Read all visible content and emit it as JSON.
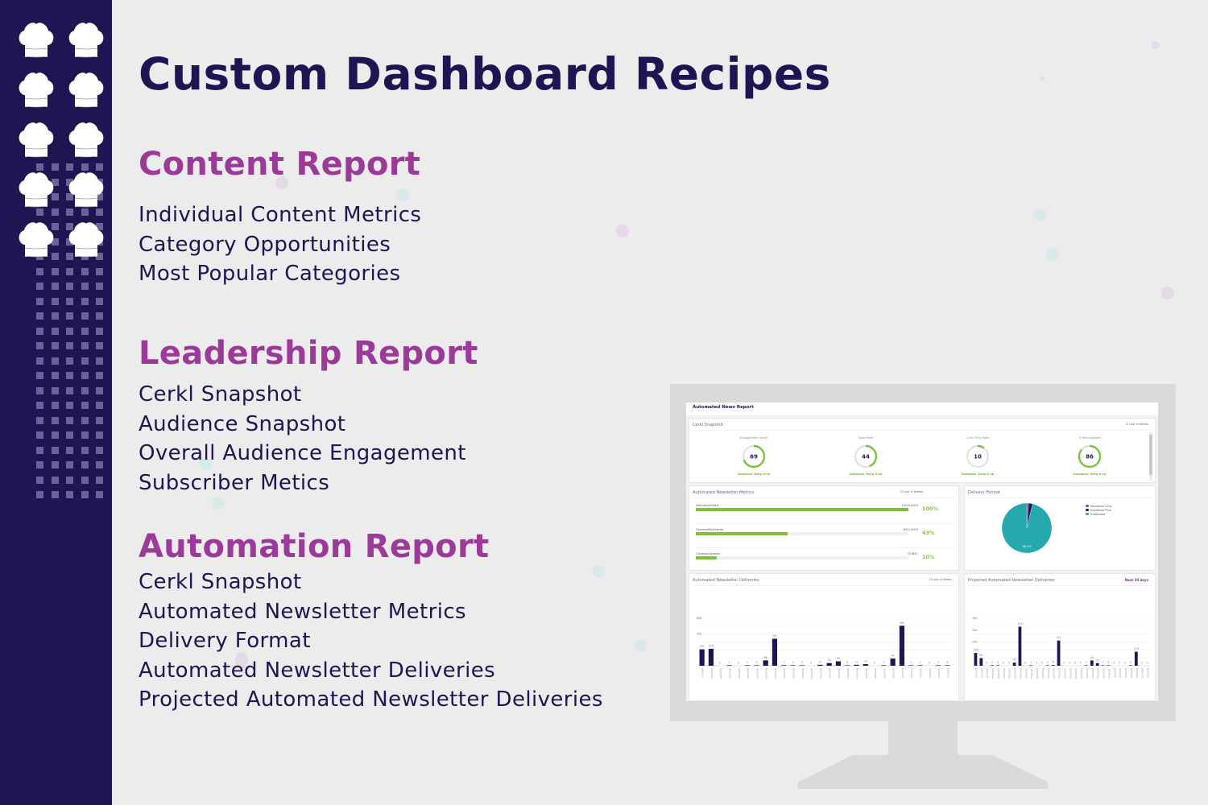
{
  "page": {
    "title": "Custom Dashboard Recipes",
    "colors": {
      "navy": "#1f1553",
      "purple": "#9b3a99",
      "background": "#ececec",
      "green": "#7dc23d",
      "teal": "#25a8ae"
    }
  },
  "sections": [
    {
      "title": "Content Report",
      "items": [
        "Individual Content Metrics",
        "Category Opportunities",
        "Most Popular Categories"
      ]
    },
    {
      "title": "Leadership Report",
      "items": [
        "Cerkl Snapshot",
        "Audience Snapshot",
        "Overall Audience Engagement",
        "Subscriber Metics"
      ]
    },
    {
      "title": "Automation Report",
      "items": [
        "Cerkl Snapshot",
        "Automated Newsletter Metrics",
        "Delivery Format",
        "Automated Newsletter Deliveries",
        "Projected Automated Newsletter Deliveries"
      ]
    }
  ],
  "sidebar": {
    "icons": [
      "chef-hat-icon",
      "chef-hat-icon",
      "chef-hat-icon",
      "chef-hat-icon",
      "chef-hat-icon",
      "chef-hat-icon",
      "chef-hat-icon",
      "chef-hat-icon",
      "chef-hat-icon",
      "chef-hat-icon"
    ]
  },
  "dashboard": {
    "header": "Automated News Report",
    "snapshot": {
      "title": "Cerkl Snapshot",
      "range": "☷ Last 4 Weeks",
      "gauges": [
        {
          "label": "Engagement Score",
          "value": 69,
          "status": "Awesome, Keep it up"
        },
        {
          "label": "Open Rate",
          "value": 44,
          "status": "Awesome, Keep it up"
        },
        {
          "label": "Click-Thru Rate",
          "value": 10,
          "status": "Awesome, Keep it up"
        },
        {
          "label": "% Personalized",
          "value": 86,
          "status": "Awesome, Keep it up"
        }
      ]
    },
    "metrics": {
      "title": "Automated Newsletter Metrics",
      "range": "☷ Last 4 Weeks",
      "rows": [
        {
          "label": "Delivered/Sent",
          "count": "1505/1505",
          "percent": "100%",
          "fraction": 1.0
        },
        {
          "label": "Opened/Delivered",
          "count": "651/1505",
          "percent": "43%",
          "fraction": 0.43
        },
        {
          "label": "Clicked/Opened",
          "count": "72/651",
          "percent": "10%",
          "fraction": 0.1
        }
      ]
    },
    "delivery_format": {
      "title": "Delivery Format",
      "legend": [
        {
          "label": "Headlines Only",
          "color": "#9b3a99"
        },
        {
          "label": "Headlines Plus",
          "color": "#1f1553"
        },
        {
          "label": "Traditional",
          "color": "#25a8ae"
        }
      ],
      "center_label": "96.2%"
    },
    "deliveries": {
      "title": "Automated Newsletter Deliveries",
      "range": "☷ Last 4 Weeks"
    },
    "projected": {
      "title": "Projected Automated Newsletter Deliveries",
      "range": "Next 30 days"
    }
  },
  "chart_data": [
    {
      "type": "pie",
      "title": "Delivery Format",
      "categories": [
        "Headlines Only",
        "Headlines Plus",
        "Traditional"
      ],
      "values": [
        1.2,
        2.6,
        96.2
      ],
      "data_labels": [
        "",
        "",
        "96.2%"
      ],
      "legend": "top-right"
    },
    {
      "type": "bar",
      "title": "Automated Newsletter Deliveries",
      "categories": [
        "4/9/2019",
        "4/10/2019",
        "4/11/2019",
        "4/12/2019",
        "4/13/2019",
        "4/14/2019",
        "4/15/2019",
        "4/16/2019",
        "4/17/2019",
        "4/18/2019",
        "4/19/2019",
        "4/20/2019",
        "4/21/2019",
        "4/22/2019",
        "4/23/2019",
        "4/24/2019",
        "4/25/2019",
        "4/26/2019",
        "4/27/2019",
        "4/28/2019",
        "4/29/2019",
        "4/30/2019",
        "5/1/2019",
        "5/2/2019",
        "5/3/2019",
        "5/4/2019",
        "5/5/2019",
        "5/6/2019"
      ],
      "values": [
        207,
        214,
        0,
        1,
        0,
        1,
        3,
        68,
        341,
        7,
        3,
        3,
        0,
        12,
        34,
        56,
        6,
        12,
        20,
        0,
        1,
        90,
        505,
        1,
        3,
        0,
        3,
        6
      ],
      "data_labels": [
        "207",
        "214",
        "0",
        "1",
        "0",
        "1",
        "3",
        "68",
        "341",
        "7",
        "3",
        "3",
        "0",
        "12",
        "34",
        "56",
        "6",
        "12",
        "20",
        "0",
        "1",
        "90",
        "505",
        "1",
        "3",
        "0",
        "3",
        "6"
      ],
      "yticks": [
        400,
        600
      ],
      "ylim": [
        0,
        600
      ],
      "grid": true
    },
    {
      "type": "bar",
      "title": "Projected Automated Newsletter Deliveries",
      "categories": [
        "5/7/2019",
        "5/8/2019",
        "5/9/2019",
        "5/10/2019",
        "5/11/2019",
        "5/12/2019",
        "5/13/2019",
        "5/14/2019",
        "5/15/2019",
        "5/16/2019",
        "5/17/2019",
        "5/18/2019",
        "5/19/2019",
        "5/20/2019",
        "5/21/2019",
        "5/22/2019",
        "5/23/2019",
        "5/24/2019",
        "5/25/2019",
        "5/26/2019",
        "5/27/2019",
        "5/28/2019",
        "5/29/2019",
        "5/30/2019",
        "5/31/2019",
        "6/1/2019",
        "6/2/2019",
        "6/3/2019",
        "6/4/2019",
        "6/5/2019",
        "6/6/2019",
        "6/7/2019",
        "6/8/2019",
        "6/9/2019",
        "6/10/2019"
      ],
      "values": [
        108,
        64,
        0,
        2,
        4,
        0,
        0,
        26,
        329,
        0,
        1,
        0,
        0,
        3,
        6,
        212,
        0,
        0,
        0,
        0,
        1,
        44,
        22,
        1,
        2,
        0,
        0,
        0,
        4,
        118,
        0,
        0
      ],
      "data_labels": [
        "108",
        "64",
        "0",
        "2",
        "4",
        "0",
        "0",
        "26",
        "329",
        "0",
        "1",
        "0",
        "0",
        "3",
        "6",
        "212",
        "0",
        "0",
        "0",
        "0",
        "1",
        "44",
        "22",
        "1",
        "2",
        "0",
        "0",
        "0",
        "4",
        "118",
        "0",
        "0"
      ],
      "yticks": [
        200,
        300,
        400
      ],
      "ylim": [
        0,
        400
      ],
      "grid": true
    }
  ]
}
